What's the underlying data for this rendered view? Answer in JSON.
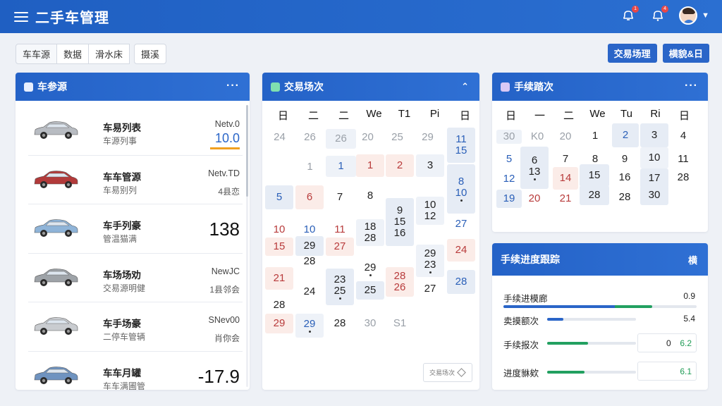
{
  "header": {
    "title": "二手车管理",
    "notification_count": "1",
    "alert_count": "4"
  },
  "toolbar": {
    "tabs": [
      "车车源",
      "数据",
      "滑水床",
      "摄溪"
    ],
    "right_buttons": [
      "交易场理",
      "横貌&日"
    ]
  },
  "vehicles_panel": {
    "title": "车参源",
    "more": "···",
    "items": [
      {
        "name": "车易列表",
        "sub": "车源列事",
        "tag": "Netv.0",
        "value": "10.0",
        "car_color": "#b8bcc2"
      },
      {
        "name": "车车管源",
        "sub": "车易别列",
        "tag": "Netv.TD",
        "small": "4县恋",
        "car_color": "#b23a3a"
      },
      {
        "name": "车手列豪",
        "sub": "管温猫满",
        "big": "138",
        "car_color": "#8fb4d8"
      },
      {
        "name": "车场场劝",
        "sub": "交易源明健",
        "tag": "NewJC",
        "small": "1县邻会",
        "car_color": "#9ea3a8"
      },
      {
        "name": "车手场豪",
        "sub": "二停车管辆",
        "tag": "SNev00",
        "small": "肖你会",
        "car_color": "#c9ccd0"
      },
      {
        "name": "车车月罐",
        "sub": "车车满圃管",
        "big": "-17.9",
        "car_color": "#6f93c0"
      }
    ]
  },
  "calendar_main": {
    "title": "交易场次",
    "weekdays": [
      "日",
      "二",
      "二",
      "We",
      "T1",
      "Pi",
      "日"
    ],
    "footer": "交易场次"
  },
  "calendar_fees": {
    "title": "手续踏次",
    "more": "···",
    "weekdays": [
      "日",
      "一",
      "二",
      "We",
      "Tu",
      "Ri",
      "日"
    ]
  },
  "progress_panel": {
    "title": "手续进度跟踪",
    "action": "横",
    "rows": [
      {
        "label": "手续进模廊",
        "value": "0.9",
        "progress": 0.77
      },
      {
        "label": "卖摸额次",
        "value": "5.4",
        "progress": 0.18
      },
      {
        "label": "手续报次",
        "value_a": "0",
        "value_b": "6.2",
        "progress": 0.46
      },
      {
        "label": "进度貅欸",
        "value_b": "6.1",
        "progress": 0.42
      }
    ]
  },
  "colors": {
    "primary": "#2a65c8",
    "holiday_red": "#b83b3b",
    "success": "#1f9b55",
    "accent_orange": "#f0a020"
  }
}
